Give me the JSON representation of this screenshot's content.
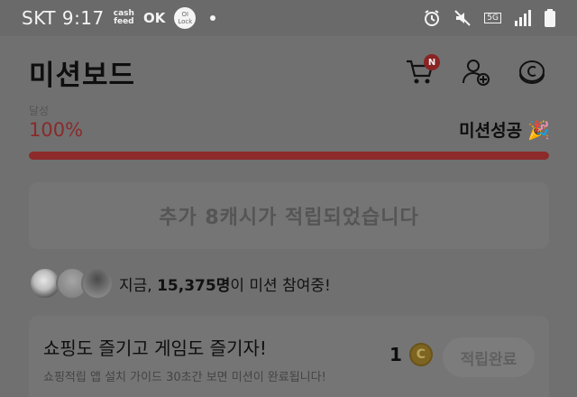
{
  "status_bar": {
    "carrier": "SKT",
    "time": "9:17",
    "cashfeed_badge": "cash\nfeed",
    "ok_badge": "OK",
    "lock_badge": "OI\nLock",
    "network": "5G"
  },
  "header": {
    "title": "미션보드",
    "cart_badge": "N"
  },
  "progress": {
    "cut_label": "달성",
    "percent_text": "100%",
    "fraction": 1.0,
    "success_text": "미션성공",
    "success_emoji": "🎉"
  },
  "notice": {
    "text": "추가 8캐시가 적립되었습니다"
  },
  "participants": {
    "prefix": "지금, ",
    "count": "15,375명",
    "suffix": "이 미션 참여중!"
  },
  "mission": {
    "title": "쇼핑도 즐기고 게임도 즐기자!",
    "description": "쇼핑적립 앱 설치 가이드 30초간 보면 미션이 완료됩니다!",
    "reward_count": "1",
    "coin_symbol": "C",
    "button_label": "적립완료"
  },
  "colors": {
    "accent": "#8d2a2a",
    "overlay_bg": "#707070"
  }
}
